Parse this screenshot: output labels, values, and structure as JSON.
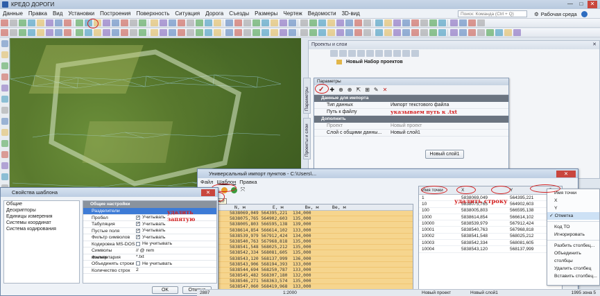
{
  "app": {
    "title": "КРЕДО ДОРОГИ",
    "window_controls": [
      "—",
      "□",
      "✕"
    ]
  },
  "menu": [
    "Данные",
    "Правка",
    "Вид",
    "Установки",
    "Построения",
    "Поверхность",
    "Ситуация",
    "Дорога",
    "Съезды",
    "Размеры",
    "Чертеж",
    "Ведомости",
    "3D-вид"
  ],
  "command_search_placeholder": "Поиск: Команда (Ctrl + Q)",
  "workspace_label": "Рабочая среда",
  "projects_panel": {
    "title": "Проекты и слои",
    "new_set": "Новый Набор проектов"
  },
  "side_tabs": {
    "params": "Параметры",
    "projects": "Проекты и слои"
  },
  "params_dialog": {
    "title": "Параметры",
    "section_import": "Данные для импорта",
    "data_type_label": "Тип данных",
    "data_type_value": "Импорт текстового файла",
    "path_label": "Путь к файлу",
    "path_annotation": "указываем путь к .txt",
    "section_extra": "Дополнить",
    "project_label": "Проект",
    "project_value": "Новый проект",
    "layer_label": "Слой с общими данны...",
    "layer_value": "Новый слой1",
    "layer_button": "Новый слой1"
  },
  "import_window": {
    "title": "Универсальный импорт пунктов - C:\\Users\\...",
    "menu": [
      "Файл",
      "Шаблон",
      "Правка"
    ],
    "close_tooltip": "Закрыт",
    "raw_header": "Имя        N, м          E, м        Вн, м     Вe, м",
    "raw_rows": [
      "5838069,049 564395,221  134,000",
      "5838075,765 564902,603  135,000",
      "5838005,803 566595,138  139,000",
      "5838614,854 566614,102  133,000",
      "5838539,979 567912,424  134,000",
      "5838540,763 567968,818  135,000",
      "5838541,548 568025,212  135,000",
      "5838542,334 568081,605  135,000",
      "5838543,120 568137,999  136,000",
      "5838543,906 568194,393  133,000",
      "5838544,694 568250,787  133,000",
      "5838545,482 568307,180  132,000",
      "5838546,271 568363,574  135,000",
      "5838547,060 568419,968  133,000"
    ],
    "result_headers": [
      "Имя точки",
      "X",
      "Y",
      "Отметка"
    ],
    "result_rows": [
      [
        "1",
        "5838069,049",
        "564395,221",
        "13"
      ],
      [
        "10",
        "5838075,765",
        "564902,603",
        "13"
      ],
      [
        "100",
        "5838005,803",
        "566595,138",
        "13"
      ],
      [
        "1000",
        "5838614,854",
        "566614,102",
        "13"
      ],
      [
        "10000",
        "5838539,979",
        "567912,424",
        "13"
      ],
      [
        "10001",
        "5838540,763",
        "567968,818",
        "13"
      ],
      [
        "10002",
        "5838541,548",
        "568025,212",
        "13"
      ],
      [
        "10003",
        "5838542,334",
        "568081,605",
        "13"
      ],
      [
        "10004",
        "5838543,120",
        "568137,999",
        "13"
      ]
    ],
    "delete_annotation": "удалить строку"
  },
  "template_window": {
    "title": "Свойства шаблона",
    "nav": [
      "Общие",
      "Дескрипторы",
      "Единицы измерения",
      "Системы координат",
      "Система кодирования"
    ],
    "section": "Общие настройки",
    "props": [
      {
        "k": "Разделители",
        "v": "",
        "sel": true
      },
      {
        "k": "Пробел",
        "v": "Учитывать",
        "chk": true
      },
      {
        "k": "Табуляция",
        "v": "Учитывать",
        "chk": true
      },
      {
        "k": "Пустые поля",
        "v": "Учитывать",
        "chk": true
      },
      {
        "k": "Фильтр символов",
        "v": "Учитывать",
        "chk": true
      },
      {
        "k": "Кодировка MS-DOS",
        "v": "Не учитывать",
        "chk": false
      },
      {
        "k": "Символы комментария",
        "v": "// @ rem"
      },
      {
        "k": "Фильтр",
        "v": "*.txt"
      },
      {
        "k": "Объединять строки",
        "v": "Не учитывать",
        "chk": false
      },
      {
        "k": "Количество строк",
        "v": "2"
      }
    ],
    "delete_comma_annotation": "удалить запятую",
    "ok": "OK",
    "cancel": "Отмена"
  },
  "context_menu": {
    "items": [
      "Имя точки",
      "X",
      "Y",
      "Отметка",
      "Код ТО",
      "Игнорировать",
      "Разбить столбец...",
      "Объединить столбцы",
      "Удалить столбец",
      "Вставить столбец..."
    ],
    "selected": "Отметка"
  },
  "status": {
    "coord": "2887",
    "scale": "1:2000",
    "project": "Новый проект",
    "layer": "Новый слой1",
    "zone": "1995 зона 5"
  }
}
